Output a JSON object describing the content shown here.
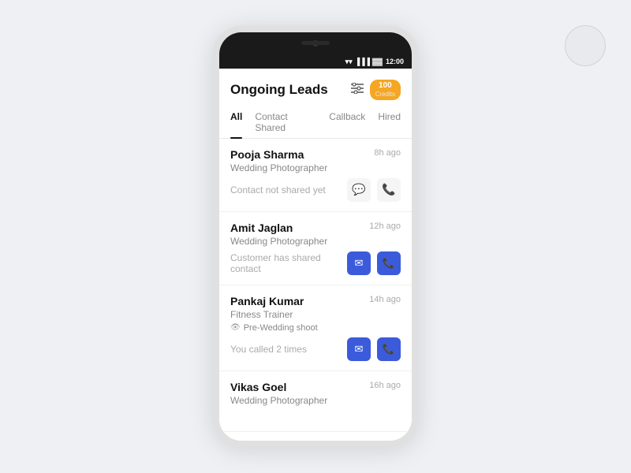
{
  "fab": {
    "label": ""
  },
  "status_bar": {
    "time": "12:00"
  },
  "header": {
    "title": "Ongoing Leads",
    "filter_icon": "☰",
    "credits": "100",
    "credits_label": "Credits"
  },
  "tabs": [
    {
      "label": "All",
      "active": true
    },
    {
      "label": "Contact Shared",
      "active": false
    },
    {
      "label": "Callback",
      "active": false
    },
    {
      "label": "Hired",
      "active": false
    }
  ],
  "leads": [
    {
      "name": "Pooja Sharma",
      "time": "8h ago",
      "role": "Wedding Photographer",
      "tag": null,
      "status": "Contact not shared yet",
      "msg_active": false,
      "phone_active": false
    },
    {
      "name": "Amit Jaglan",
      "time": "12h ago",
      "role": "Wedding Photographer",
      "tag": null,
      "status": "Customer has shared contact",
      "msg_active": true,
      "phone_active": true
    },
    {
      "name": "Pankaj Kumar",
      "time": "14h ago",
      "role": "Fitness Trainer",
      "tag": "Pre-Wedding shoot",
      "status": "You called 2 times",
      "msg_active": true,
      "phone_active": true
    },
    {
      "name": "Vikas Goel",
      "time": "16h ago",
      "role": "Wedding Photographer",
      "tag": null,
      "status": null,
      "msg_active": false,
      "phone_active": false
    }
  ]
}
